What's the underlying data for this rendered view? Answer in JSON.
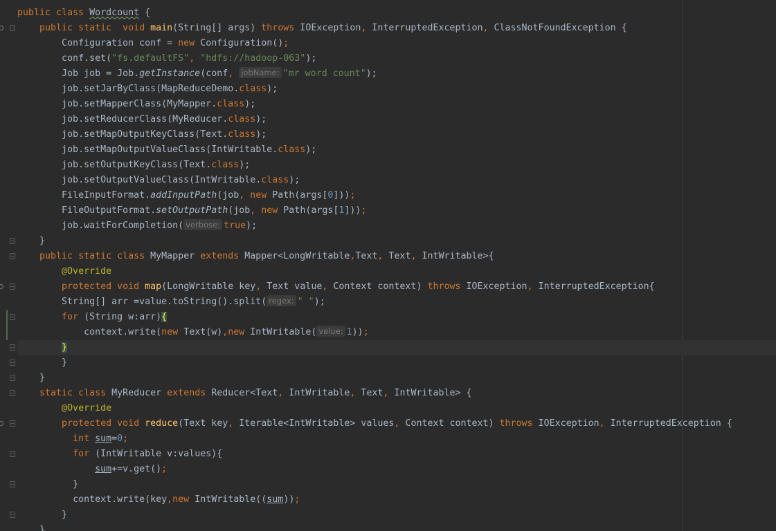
{
  "editor": {
    "language": "java",
    "colors": {
      "background": "#2b2b2b",
      "keyword": "#cc7832",
      "string": "#6a8759",
      "number": "#6897bb",
      "method_decl": "#ffc66d",
      "annotation": "#bbb529",
      "plain": "#a9b7c6"
    },
    "code": {
      "l1_kw": "public class ",
      "l1_cls": "Wordcount",
      "l1_rest": " {",
      "l2_kw1": "public static  void ",
      "l2_fn": "main",
      "l2_a": "(String[] args) ",
      "l2_kw2": "throws ",
      "l2_b": "IOException",
      "l2_c": ", ",
      "l2_d": "InterruptedException",
      "l2_e": ", ",
      "l2_f": "ClassNotFoundException {",
      "l3_a": "Configuration conf = ",
      "l3_kw": "new ",
      "l3_b": "Configuration()",
      "l3_semi": ";",
      "l4_a": "conf.set(",
      "l4_s1": "\"fs.defaultFS\"",
      "l4_c": ", ",
      "l4_s2": "\"hdfs://hadoop-063\"",
      "l4_e": ");",
      "l5_a": "Job job = Job.",
      "l5_it": "getInstance",
      "l5_b": "(conf",
      "l5_c": ", ",
      "l5_hint": "jobName:",
      "l5_s": "\"mr word count\"",
      "l5_e": ");",
      "l6_a": "job.setJarByClass(MapReduceDemo.",
      "l6_kw": "class",
      "l6_e": ");",
      "l7_a": "job.setMapperClass(MyMapper.",
      "l7_kw": "class",
      "l7_e": ");",
      "l8_a": "job.setReducerClass(MyReducer.",
      "l8_kw": "class",
      "l8_e": ");",
      "l9_a": "job.setMapOutputKeyClass(Text.",
      "l9_kw": "class",
      "l9_e": ");",
      "l10_a": "job.setMapOutputValueClass(IntWritable.",
      "l10_kw": "class",
      "l10_e": ");",
      "l11_a": "job.setOutputKeyClass(Text.",
      "l11_kw": "class",
      "l11_e": ");",
      "l12_a": "job.setOutputValueClass(IntWritable.",
      "l12_kw": "class",
      "l12_e": ");",
      "l13_a": "FileInputFormat.",
      "l13_it": "addInputPath",
      "l13_b": "(job",
      "l13_c": ", ",
      "l13_kw": "new ",
      "l13_d": "Path(args[",
      "l13_n": "0",
      "l13_e": "]))",
      "l13_semi": ";",
      "l14_a": "FileOutputFormat.",
      "l14_it": "setOutputPath",
      "l14_b": "(job",
      "l14_c": ", ",
      "l14_kw": "new ",
      "l14_d": "Path(args[",
      "l14_n": "1",
      "l14_e": "]))",
      "l14_semi": ";",
      "l15_a": "job.waitForCompletion(",
      "l15_hint": "verbose:",
      "l15_kw": "true",
      "l15_e": ");",
      "l16": "}",
      "l17_kw1": "public static class ",
      "l17_a": "MyMapper ",
      "l17_kw2": "extends ",
      "l17_b": "Mapper<LongWritable",
      "l17_c": ",",
      "l17_d": "Text",
      "l17_e": ", ",
      "l17_f": "Text",
      "l17_g": ", ",
      "l17_h": "IntWritable>{",
      "l18_ann": "@Override",
      "l19_kw1": "protected void ",
      "l19_fn": "map",
      "l19_a": "(LongWritable key",
      "l19_c1": ", ",
      "l19_b": "Text value",
      "l19_c2": ", ",
      "l19_d": "Context context) ",
      "l19_kw2": "throws ",
      "l19_e": "IOException",
      "l19_c3": ", ",
      "l19_f": "InterruptedException{",
      "l20_a": "String[] arr =value.toString().split(",
      "l20_hint": "regex:",
      "l20_s": "\" \"",
      "l20_e": ");",
      "l21_kw": "for ",
      "l21_a": "(String w:arr)",
      "l21_brace": "{",
      "l22_a": "context.write(",
      "l22_kw1": "new ",
      "l22_b": "Text(w)",
      "l22_c": ",",
      "l22_kw2": "new ",
      "l22_d": "IntWritable(",
      "l22_hint": "value:",
      "l22_n": "1",
      "l22_e": "))",
      "l22_semi": ";",
      "l23_brace": "}",
      "l24": "}",
      "l25": "}",
      "l26_kw1": "static class ",
      "l26_a": "MyReducer ",
      "l26_kw2": "extends ",
      "l26_b": "Reducer<Text",
      "l26_c1": ", ",
      "l26_d": "IntWritable",
      "l26_c2": ", ",
      "l26_e": "Text",
      "l26_c3": ", ",
      "l26_f": "IntWritable> {",
      "l27_ann": "@Override",
      "l28_kw1": "protected void ",
      "l28_fn": "reduce",
      "l28_a": "(Text key",
      "l28_c1": ", ",
      "l28_b": "Iterable<IntWritable> values",
      "l28_c2": ", ",
      "l28_d": "Context context) ",
      "l28_kw2": "throws ",
      "l28_e": "IOException",
      "l28_c3": ", ",
      "l28_f": "InterruptedException {",
      "l29_kw": "int ",
      "l29_var": "sum",
      "l29_a": "=",
      "l29_n": "0",
      "l29_semi": ";",
      "l30_kw": "for ",
      "l30_a": "(IntWritable v:values){",
      "l31_var": "sum",
      "l31_a": "+=v.get()",
      "l31_semi": ";",
      "l32": "}",
      "l33_a": "context.write(key",
      "l33_c": ",",
      "l33_kw": "new ",
      "l33_b": "IntWritable((",
      "l33_var": "sum",
      "l33_e": "))",
      "l33_semi": ";",
      "l34": "}",
      "l35": "}"
    }
  }
}
